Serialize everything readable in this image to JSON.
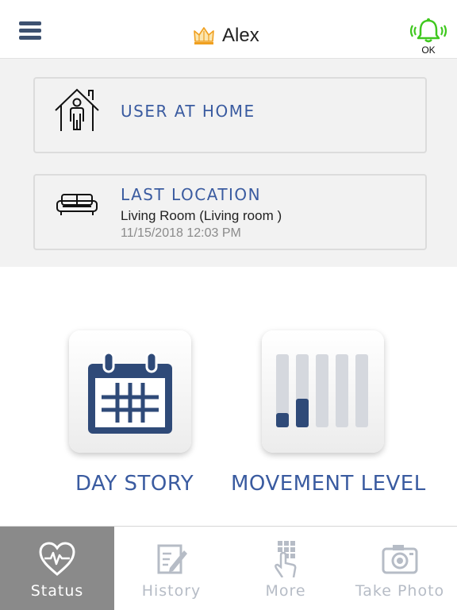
{
  "header": {
    "user_name": "Alex",
    "alarm_status": "OK",
    "icons": {
      "menu": "hamburger-icon",
      "user": "crown-icon",
      "alarm": "bell-ringing-icon"
    }
  },
  "status_cards": {
    "home": {
      "title": "USER AT HOME",
      "icon": "house-person-icon"
    },
    "location": {
      "title": "LAST LOCATION",
      "room": "Living Room (Living room )",
      "timestamp": "11/15/2018 12:03 PM",
      "icon": "sofa-icon"
    }
  },
  "tiles": {
    "day_story": {
      "label": "DAY STORY",
      "icon": "calendar-icon"
    },
    "movement": {
      "label": "MOVEMENT LEVEL",
      "icon": "bar-level-icon",
      "level": 2,
      "max_level": 5
    }
  },
  "tabbar": {
    "tabs": [
      {
        "label": "Status",
        "icon": "heart-pulse-icon",
        "active": true
      },
      {
        "label": "History",
        "icon": "edit-note-icon",
        "active": false
      },
      {
        "label": "More",
        "icon": "grid-tap-icon",
        "active": false
      },
      {
        "label": "Take Photo",
        "icon": "camera-icon",
        "active": false
      }
    ]
  },
  "colors": {
    "accent": "#3a5ba0",
    "dark_icon": "#2f4a78",
    "alarm_green": "#3fc81e",
    "crown": "#f0a020",
    "tab_active_bg": "#8a8a8a",
    "tab_inactive": "#b6bcc6",
    "panel_bg": "#f2f2f2"
  }
}
